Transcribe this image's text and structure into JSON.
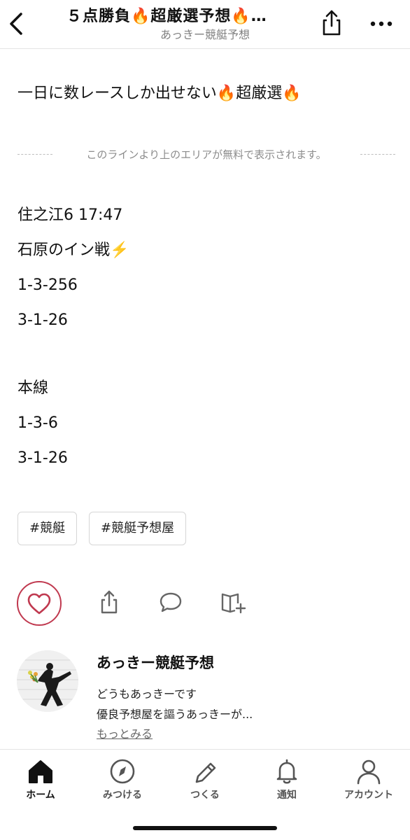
{
  "header": {
    "title": "５点勝負🔥超厳選予想🔥…",
    "subtitle": "あっきー競艇予想"
  },
  "post": {
    "lead": "一日に数レースしか出せない🔥超厳選🔥",
    "free_area_notice": "このラインより上のエリアが無料で表示されます。",
    "lines": [
      "住之江6 17:47",
      "石原のイン戦⚡️",
      "1-3-256",
      "3-1-26",
      "本線",
      "1-3-6",
      "3-1-26"
    ],
    "tags": [
      "#競艇",
      "#競艇予想屋"
    ]
  },
  "author": {
    "name": "あっきー競艇予想",
    "bio_line1": "どうもあっきーです",
    "bio_line2": "優良予想屋を謳うあっきーが...",
    "more_link": "もっとみる"
  },
  "bottom_nav": [
    {
      "label": "ホーム",
      "icon": "home-icon",
      "active": true
    },
    {
      "label": "みつける",
      "icon": "compass-icon",
      "active": false
    },
    {
      "label": "つくる",
      "icon": "pencil-icon",
      "active": false
    },
    {
      "label": "通知",
      "icon": "bell-icon",
      "active": false
    },
    {
      "label": "アカウント",
      "icon": "person-icon",
      "active": false
    }
  ],
  "colors": {
    "like_accent": "#c0394f",
    "text": "#111111",
    "muted": "#808080"
  }
}
